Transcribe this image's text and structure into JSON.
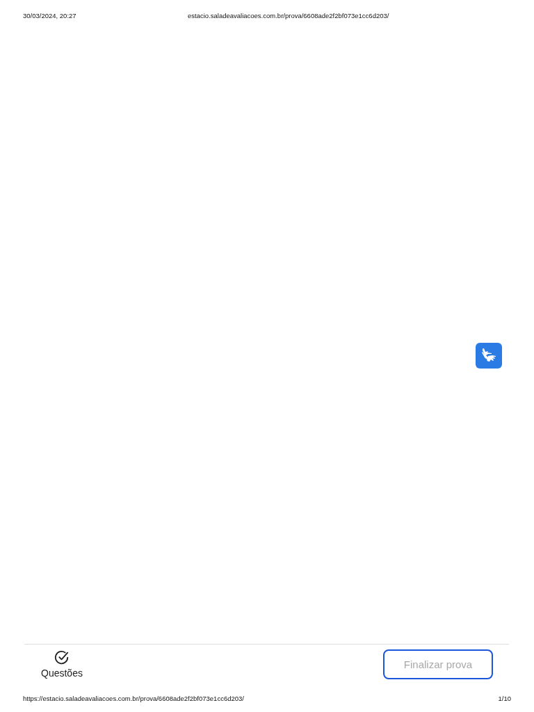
{
  "print_header": {
    "date": "30/03/2024, 20:27",
    "url": "estacio.saladeavaliacoes.com.br/prova/6608ade2f2bf073e1cc6d203/"
  },
  "bottom_bar": {
    "questions_label": "Questões",
    "finish_button": "Finalizar prova"
  },
  "print_footer": {
    "url": "https://estacio.saladeavaliacoes.com.br/prova/6608ade2f2bf073e1cc6d203/",
    "page": "1/10"
  }
}
